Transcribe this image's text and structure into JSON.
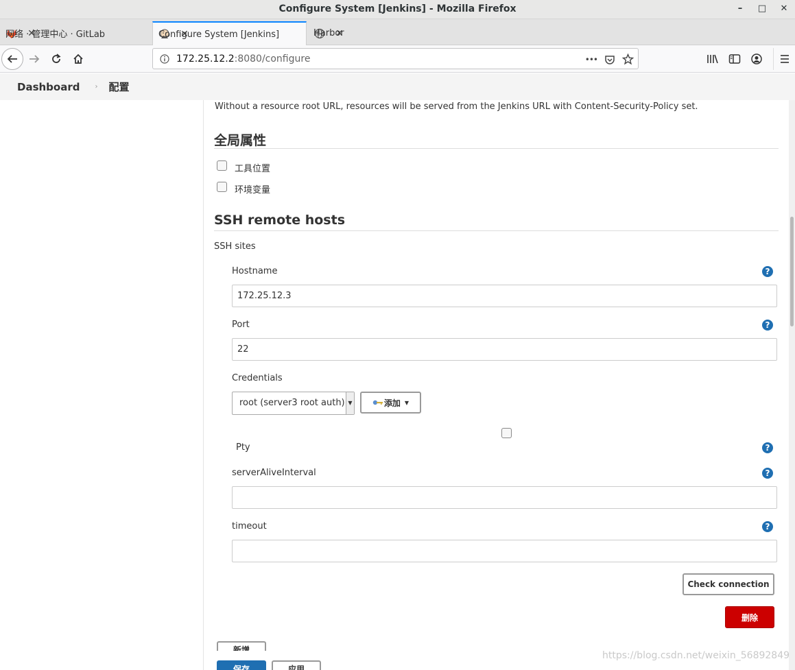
{
  "window": {
    "title": "Configure System [Jenkins] - Mozilla Firefox",
    "min": "–",
    "max": "□",
    "close": "✕"
  },
  "tabs": [
    {
      "label": "网络 · 管理中心 · GitLab",
      "close": "✕"
    },
    {
      "label": "Configure System [Jenkins]",
      "close": "✕"
    },
    {
      "label": "Harbor",
      "close": "✕"
    }
  ],
  "newtab": "+",
  "urlbar": {
    "host": "172.25.12.2",
    "path": ":8080/configure",
    "more": "•••"
  },
  "breadcrumb": {
    "home": "Dashboard",
    "sep": "›",
    "current": "配置"
  },
  "content": {
    "resource_note": "Without a resource root URL, resources will be served from the Jenkins URL with Content-Security-Policy set.",
    "global_props": {
      "title": "全局属性",
      "items": [
        {
          "label": "工具位置",
          "checked": false
        },
        {
          "label": "环境变量",
          "checked": false
        }
      ]
    },
    "ssh": {
      "title": "SSH remote hosts",
      "sites_label": "SSH sites",
      "hostname_label": "Hostname",
      "hostname_value": "172.25.12.3",
      "port_label": "Port",
      "port_value": "22",
      "credentials_label": "Credentials",
      "credentials_value": "root (server3 root auth)",
      "add_label": "添加",
      "pty_label": "Pty",
      "pty_checked": false,
      "alive_label": "serverAliveInterval",
      "alive_value": "",
      "timeout_label": "timeout",
      "timeout_value": "",
      "check_label": "Check connection",
      "delete_label": "删除",
      "new_label": "新增",
      "help": "?"
    },
    "footer": {
      "save_label": "保存",
      "apply_label": "应用"
    }
  },
  "watermark": "https://blog.csdn.net/weixin_56892849"
}
